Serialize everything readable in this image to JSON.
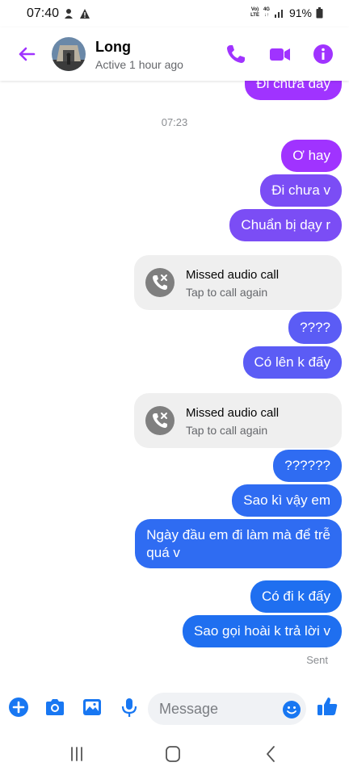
{
  "status_bar": {
    "time": "07:40",
    "network": "VoLTE 4G",
    "battery": "91%"
  },
  "header": {
    "contact_name": "Long",
    "contact_status": "Active 1 hour ago"
  },
  "thread": {
    "top_partial_message": "Đi chưa đây",
    "timestamp": "07:23",
    "messages": [
      "Ơ hay",
      "Đi chưa v",
      "Chuẩn bị dạy r",
      "????",
      "Có lên k đấy",
      "??????",
      "Sao kì vậy em",
      "Ngày đầu em đi làm mà để trễ",
      "quá v",
      "Có đi k đấy",
      "Sao gọi hoài k trả lời v"
    ],
    "missed_calls": [
      {
        "title": "Missed audio call",
        "subtitle": "Tap to call again"
      },
      {
        "title": "Missed audio call",
        "subtitle": "Tap to call again"
      }
    ],
    "sent_status": "Sent"
  },
  "composer": {
    "placeholder": "Message"
  },
  "colors": {
    "accent": "#a033ff",
    "blue": "#1f6ff0",
    "composer_icon": "#1877f2"
  },
  "icons": [
    "back-arrow-icon",
    "phone-icon",
    "video-camera-icon",
    "info-icon",
    "plus-icon",
    "camera-icon",
    "gallery-icon",
    "microphone-icon",
    "emoji-icon",
    "thumbs-up-icon",
    "missed-call-icon",
    "recent-apps-icon",
    "home-icon",
    "back-nav-icon"
  ]
}
